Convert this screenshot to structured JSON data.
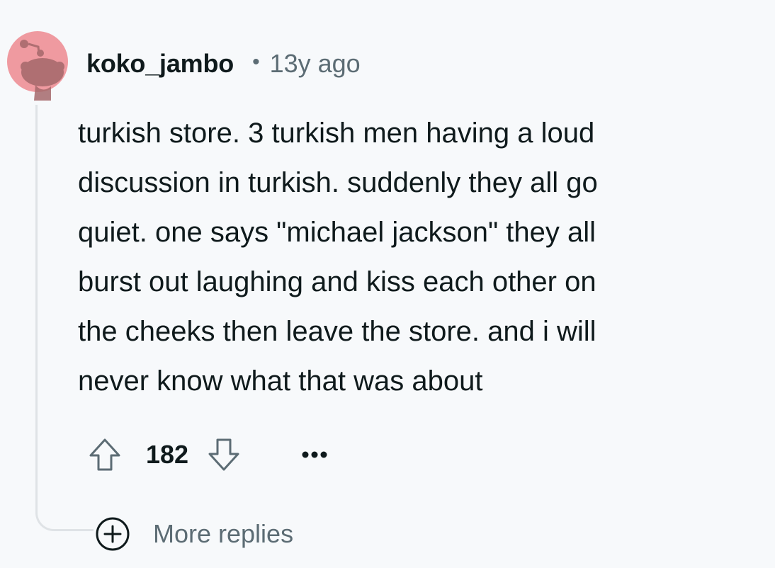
{
  "comment": {
    "author": "koko_jambo",
    "separator": "•",
    "time_ago": "13y ago",
    "avatar_icon": "snoo-avatar-icon",
    "avatar_color": "#ef9aa0",
    "body_lines": [
      "turkish store. 3 turkish men having a loud",
      "discussion in turkish. suddenly they all go",
      "quiet. one says \"michael jackson\" they all",
      "burst out laughing and kiss each other on",
      "the cheeks then leave the store. and i will",
      "never know what that was about"
    ],
    "score": "182",
    "upvote_icon": "arrow-up-icon",
    "downvote_icon": "arrow-down-icon",
    "overflow_icon": "ellipsis-icon"
  },
  "more_replies": {
    "label": "More replies",
    "icon": "plus-circle-icon"
  },
  "colors": {
    "background": "#f7f9fb",
    "text_primary": "#0f1a1c",
    "text_secondary": "#5c6c74",
    "thread_line": "#dfe3e6"
  }
}
